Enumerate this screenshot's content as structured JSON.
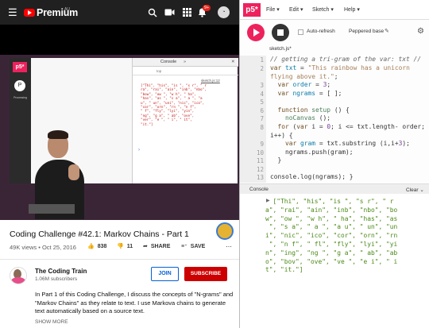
{
  "youtube": {
    "brand": "Premium",
    "region": "AU",
    "badge": "9+",
    "title": "Coding Challenge #42.1: Markov Chains - Part 1",
    "meta": "49K views • Oct 25, 2016",
    "likes": "838",
    "dislikes": "11",
    "share": "SHARE",
    "save": "SAVE",
    "channel_name": "The Coding Train",
    "subscribers": "1.06M subscribers",
    "join": "JOIN",
    "subscribe": "SUBSCRIBE",
    "description": "In Part 1 of this Coding Challenge, I discuss the concepts of \"N-grams\" and \"Markov Chains\" as they relate to text. I use Markova chains to generate text automatically based on a source text.",
    "show_more": "SHOW MORE",
    "video": {
      "p5_label": "p5*",
      "processing_label": "Processing",
      "devtools_console": "Console",
      "devtools_top": "top",
      "devtools_file": "sketch.js:12",
      "devtools_output": "[\"Thi\", \"his\", \"is \", \"s r\", \" r\nra\", \"rai\", \"ain\", \"inb\", \"nbo\",\n\"bow\", \"ow \", \"w h\", \" ha\",\n\"has\", \"as \", \"s a\", \" a \", \"a\nu\", \" un\", \"uni\", \"nic\", \"ico\",\n\"cor\", \"orn\", \"rn \", \"n f\",\n\" f\", \"fly\", \"lyi\", \"yin\",\n\"ng\", \"g a\", \" ab\", \"ove\",\n\"ver\", \"e \", \" i\", \" it\",\n\"it.\"]"
    }
  },
  "p5": {
    "logo": "p5*",
    "menus": [
      "File",
      "Edit",
      "Sketch",
      "Help"
    ],
    "auto_refresh": "Auto-refresh",
    "project_name": "Peppered base",
    "file_tab": "sketch.js*",
    "line_numbers": [
      "1",
      "2",
      "3",
      "4",
      "5",
      "6",
      "7",
      "8",
      "9",
      "10",
      "11",
      "12",
      "13"
    ],
    "console_label": "Console",
    "clear_label": "Clear",
    "console_output": "[\"Thi\", \"his\", \"is \", \"s r\", \" r\na\", \"rai\", \"ain\", \"inb\", \"nbo\", \"bo\nw\", \"ow \", \"w h\", \" ha\", \"has\", \"as\n \", \"s a\", \" a \", \"a u\", \" un\", \"un\ni\", \"nic\", \"ico\", \"cor\", \"orn\", \"rn\n \", \"n f\", \" fl\", \"fly\", \"lyi\", \"yi\nn\", \"ing\", \"ng \", \"g a\", \" ab\", \"ab\no\", \"bov\", \"ove\", \"ve \", \"e i\", \" i\nt\", \"it.\"]"
  },
  "colors": {
    "youtube_red": "#ff0000",
    "p5_pink": "#ed225d",
    "console_green": "#4a8a16"
  }
}
